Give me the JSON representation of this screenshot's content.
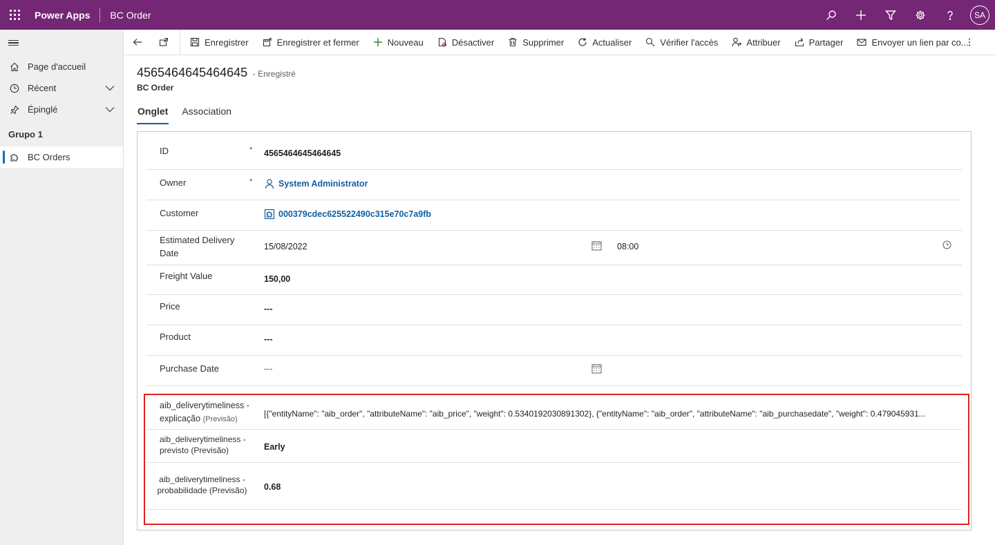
{
  "app": {
    "name": "Power Apps",
    "entity": "BC Order",
    "user_initials": "SA"
  },
  "sidebar": {
    "items": [
      {
        "label": "Page d'accueil"
      },
      {
        "label": "Récent"
      },
      {
        "label": "Épinglé"
      }
    ],
    "group": "Grupo 1",
    "group_items": [
      {
        "label": "BC Orders"
      }
    ]
  },
  "commands": [
    {
      "label": "Enregistrer",
      "icon": "save-icon"
    },
    {
      "label": "Enregistrer et fermer",
      "icon": "save-close-icon"
    },
    {
      "label": "Nouveau",
      "icon": "add-icon"
    },
    {
      "label": "Désactiver",
      "icon": "deactivate-icon"
    },
    {
      "label": "Supprimer",
      "icon": "delete-icon"
    },
    {
      "label": "Actualiser",
      "icon": "refresh-icon"
    },
    {
      "label": "Vérifier l'accès",
      "icon": "check-access-icon"
    },
    {
      "label": "Attribuer",
      "icon": "assign-icon"
    },
    {
      "label": "Partager",
      "icon": "share-icon"
    },
    {
      "label": "Envoyer un lien par co...",
      "icon": "email-link-icon"
    }
  ],
  "record": {
    "title": "4565464645464645",
    "status": "- Enregistré",
    "entity": "BC Order"
  },
  "tabs": [
    {
      "label": "Onglet"
    },
    {
      "label": "Association"
    }
  ],
  "form": {
    "id_label": "ID",
    "id_value": "4565464645464645",
    "owner_label": "Owner",
    "owner_value": "System Administrator",
    "customer_label": "Customer",
    "customer_value": "000379cdec625522490c315e70c7a9fb",
    "edd_label": "Estimated Delivery Date",
    "edd_date": "15/08/2022",
    "edd_time": "08:00",
    "freight_label": "Freight Value",
    "freight_value": "150,00",
    "price_label": "Price",
    "price_value": "---",
    "product_label": "Product",
    "product_value": "---",
    "purchase_label": "Purchase Date",
    "purchase_value": "---",
    "expl_label": "aib_deliverytimeliness - explicação",
    "expl_sub": "(Previsão)",
    "expl_value": "[{\"entityName\": \"aib_order\", \"attributeName\": \"aib_price\", \"weight\": 0.5340192030891302}, {\"entityName\": \"aib_order\", \"attributeName\": \"aib_purchasedate\", \"weight\": 0.479045931...",
    "prev_label": "aib_deliverytimeliness - previsto (Previsão)",
    "prev_value": "Early",
    "prob_label": "aib_deliverytimeliness - probabilidade (Previsão)",
    "prob_value": "0.68"
  },
  "colors": {
    "header": "#742774",
    "highlight": "#e02020",
    "link": "#115ea3"
  }
}
